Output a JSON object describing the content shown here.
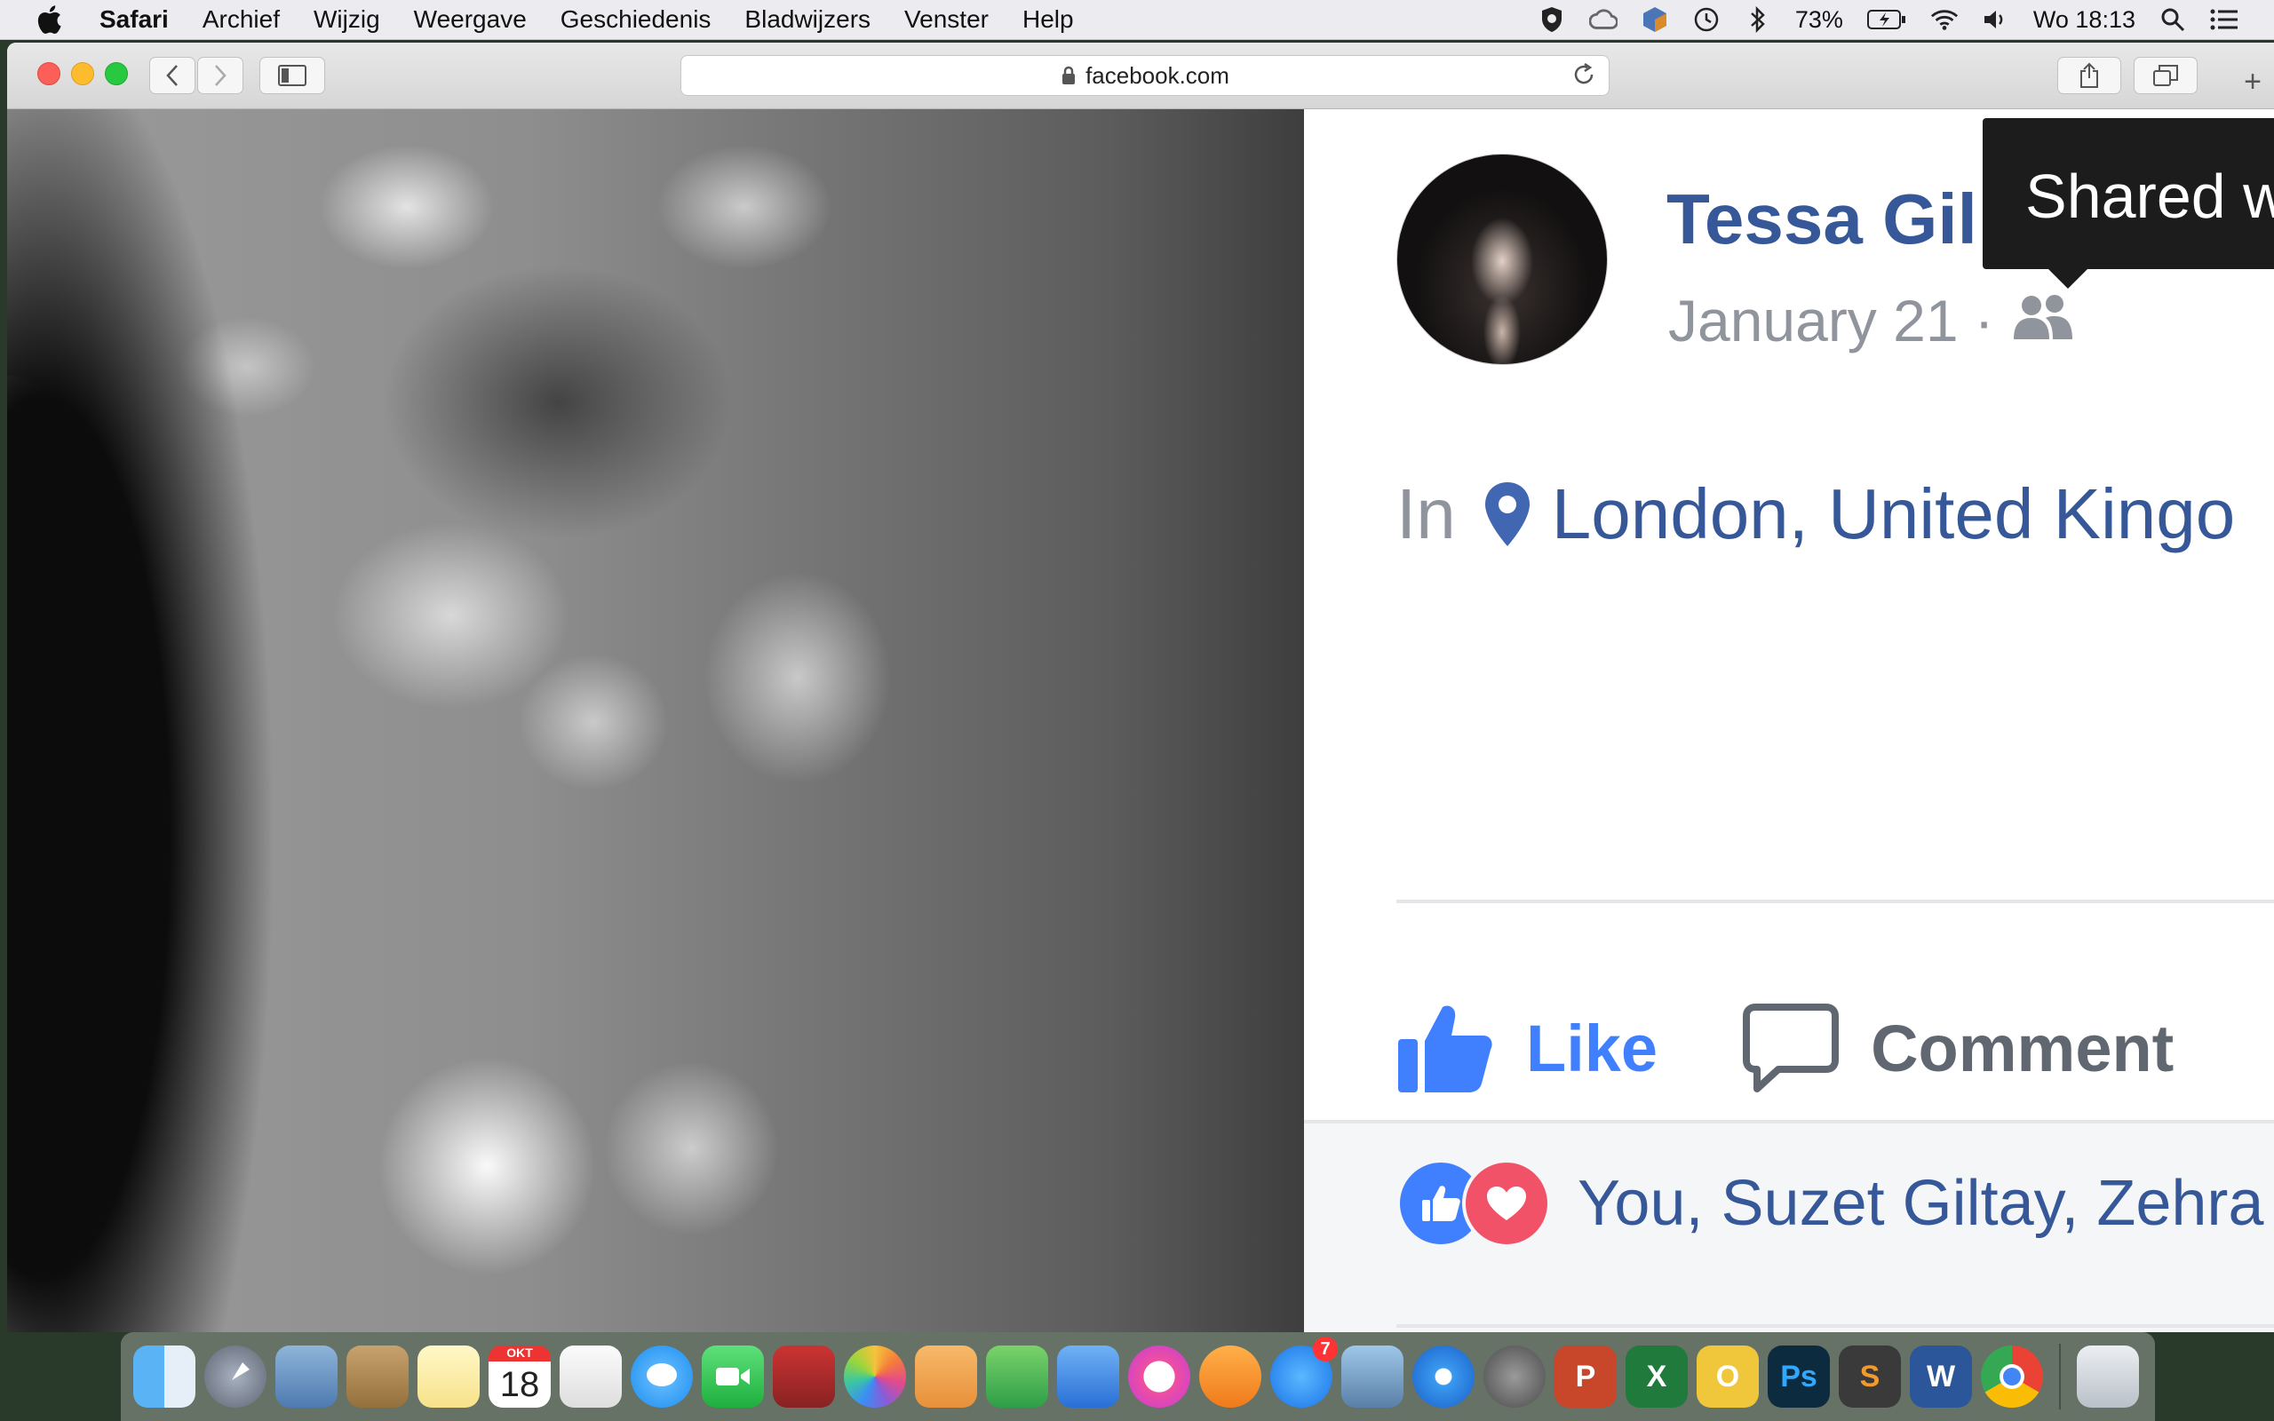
{
  "menubar": {
    "app": "Safari",
    "items": [
      "Archief",
      "Wijzig",
      "Weergave",
      "Geschiedenis",
      "Bladwijzers",
      "Venster",
      "Help"
    ],
    "battery": "73%",
    "clock": "Wo 18:13"
  },
  "browser": {
    "url": "facebook.com",
    "new_tab": "+"
  },
  "post": {
    "author": "Tessa Gil",
    "date": "January 21",
    "separator": "·",
    "tooltip": "Shared w",
    "location_prefix": "In",
    "location": "London, United Kingo",
    "like_label": "Like",
    "comment_label": "Comment",
    "reactions_names": "You, Suzet Giltay, Zehra"
  },
  "dock": {
    "calendar_month": "OKT",
    "calendar_day": "18",
    "appstore_badge": "7",
    "apps": [
      "Finder",
      "Launchpad",
      "Preview",
      "Contacts",
      "Notes",
      "Calendar",
      "Reminders",
      "Messages",
      "FaceTime",
      "Photo Booth",
      "Photos",
      "Pages",
      "Numbers",
      "Keynote",
      "iTunes",
      "iBooks",
      "App Store",
      "Image Capture",
      "Safari",
      "System Preferences",
      "PowerPoint",
      "Excel",
      "Outlook",
      "Photoshop",
      "Sublime Text",
      "Word",
      "Chrome",
      "Trash"
    ]
  },
  "colors": {
    "facebook_blue": "#365899",
    "like_blue": "#4080ff",
    "love_red": "#f25268",
    "meta_gray": "#90949c"
  }
}
